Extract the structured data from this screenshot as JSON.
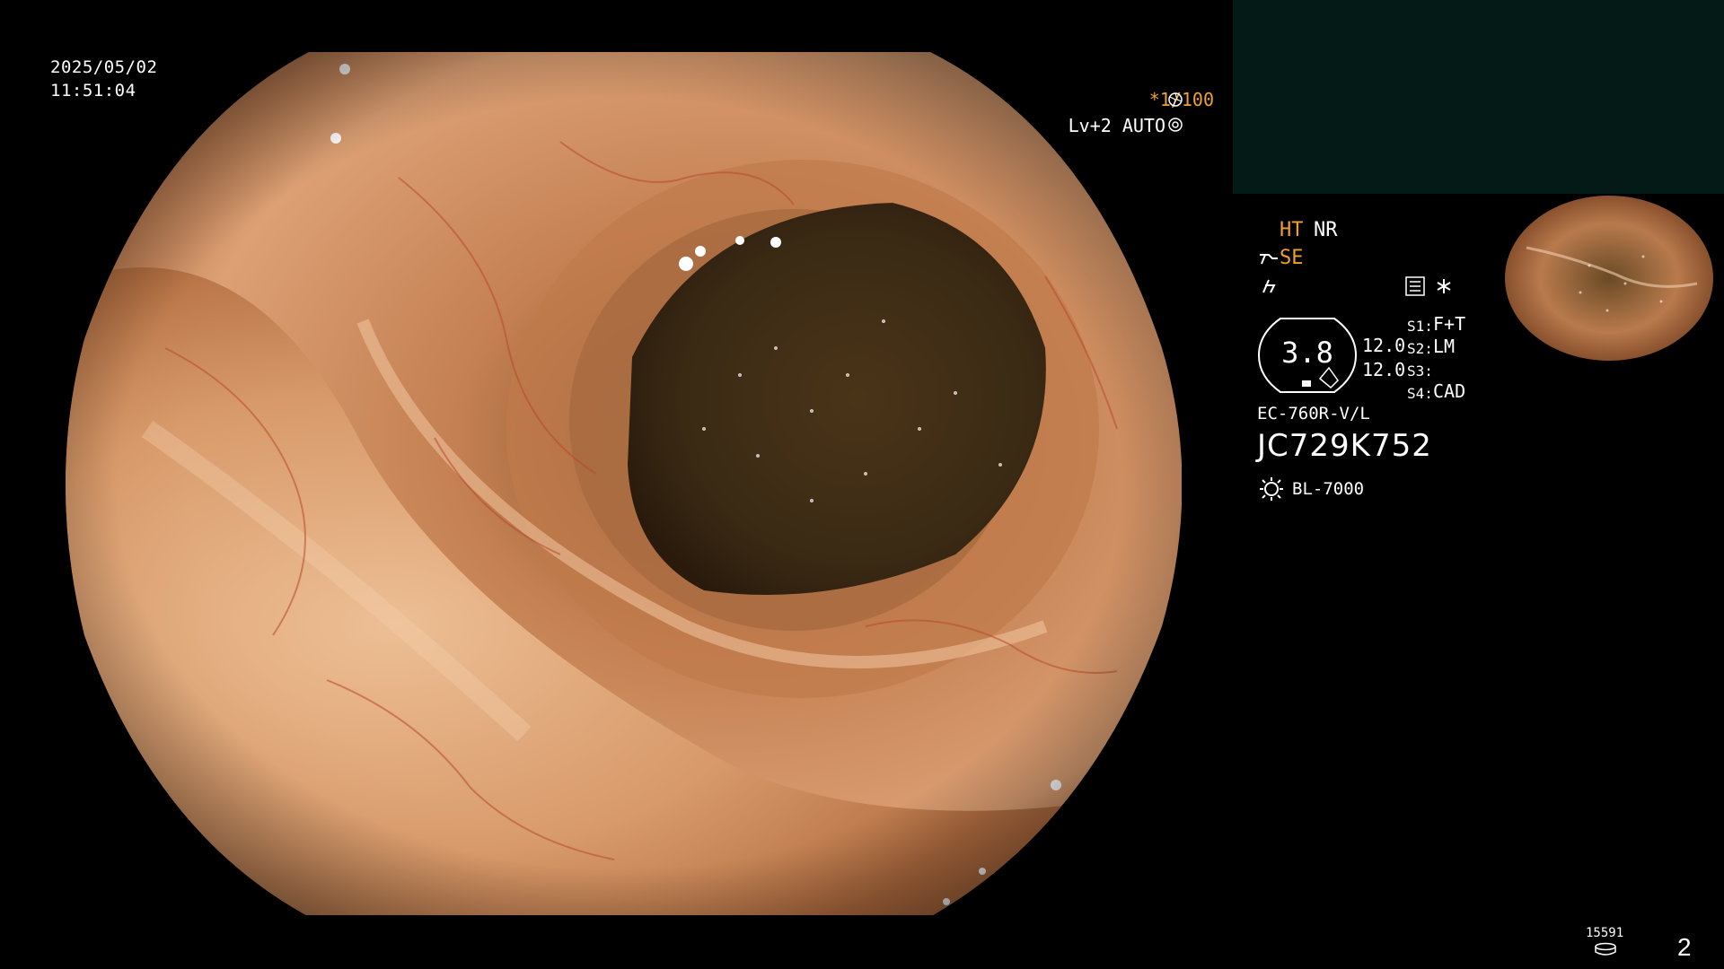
{
  "overlay": {
    "date": "2025/05/02",
    "time": "11:51:04",
    "shutter": "*1/100",
    "level": "Lv+2 AUTO",
    "ht_label": "HT",
    "nr_label": "NR",
    "se_label": "SE",
    "capsule_value": "3.8",
    "dist_1": "12.0",
    "dist_2": "12.0",
    "s1_label": "S1:",
    "s1_value": "F+T",
    "s2_label": "S2:",
    "s2_value": "LM",
    "s3_label": "S3:",
    "s3_value": "",
    "s4_label": "S4:",
    "s4_value": "CAD",
    "model": "EC-760R-V/L",
    "serial": "JC729K752",
    "light_source": "BL-7000",
    "storage_count": "15591",
    "page_number": "2"
  },
  "colors": {
    "accent": "#f0a030",
    "pip_bg": "#031a17",
    "tissue_light": "#e9b48a",
    "tissue_mid": "#c9774a",
    "lumen": "#3a2a14"
  },
  "icons": [
    "shutter-icon",
    "auto-icon",
    "scope-tip-icon",
    "flash-icon",
    "settings-list-icon",
    "asterisk-icon",
    "light-source-icon",
    "storage-icon"
  ]
}
